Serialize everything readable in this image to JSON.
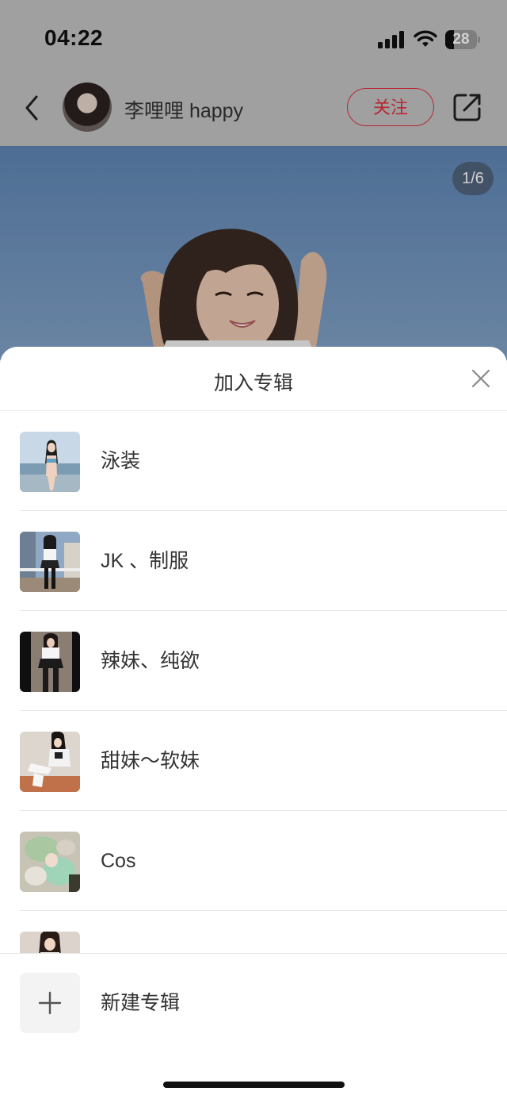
{
  "status_bar": {
    "time": "04:22",
    "battery_level": "28",
    "battery_fraction": 0.28,
    "icons": [
      "signal-icon",
      "wifi-icon",
      "battery-icon"
    ]
  },
  "nav": {
    "author_name": "李哩哩 happy",
    "follow_label": "关注",
    "icons": [
      "back-icon",
      "share-icon"
    ]
  },
  "post": {
    "image_counter": "1/6"
  },
  "sheet": {
    "title": "加入专辑",
    "albums": [
      {
        "label": "泳装"
      },
      {
        "label": "JK 、制服"
      },
      {
        "label": "辣妹、纯欲"
      },
      {
        "label": "甜妹～软妹"
      },
      {
        "label": "Cos"
      },
      {
        "label": ""
      }
    ],
    "new_album_label": "新建专辑"
  },
  "colors": {
    "accent": "#e0303f",
    "header_bg": "#c4c4c4",
    "text": "#333333"
  }
}
